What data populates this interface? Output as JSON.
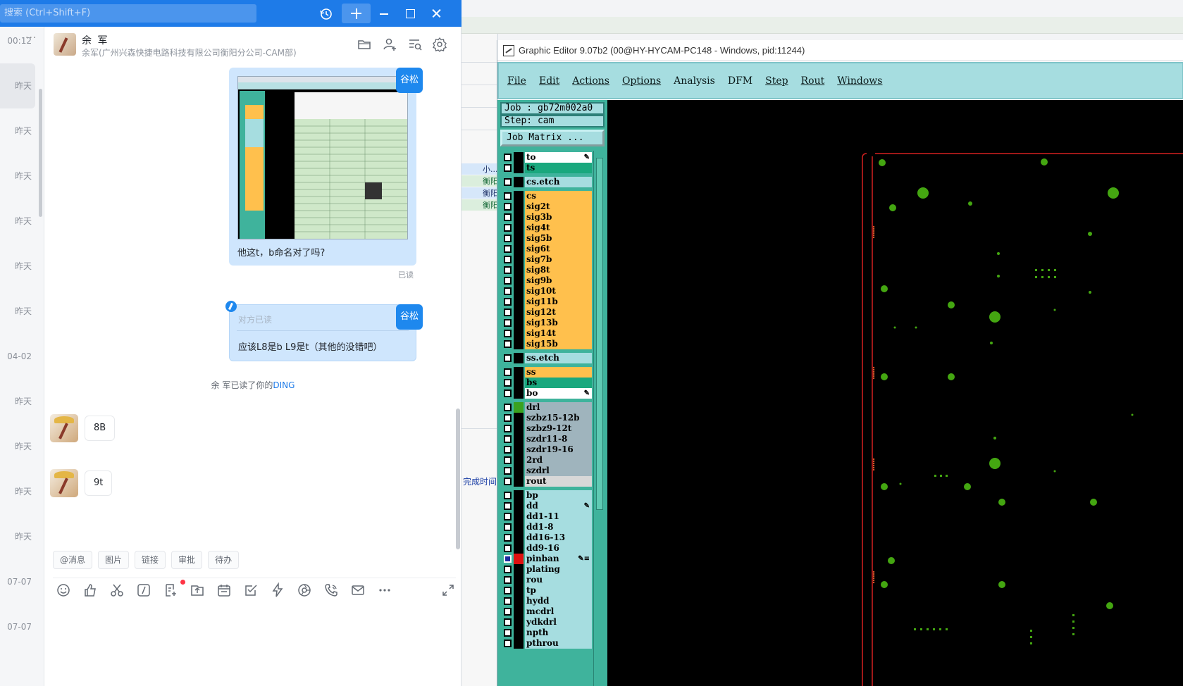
{
  "chat": {
    "search_placeholder": "搜索 (Ctrl+Shift+F)",
    "conversation_times": [
      "00:12",
      "昨天",
      "昨天",
      "昨天",
      "昨天",
      "昨天",
      "昨天",
      "04-02",
      "昨天",
      "昨天",
      "昨天",
      "昨天",
      "07-07",
      "07-07"
    ],
    "header": {
      "name": "余 军",
      "subtitle": "余军(广州兴森快捷电路科技有限公司衡阳分公司-CAM部)"
    },
    "my_name": "谷松",
    "messages": {
      "m1_text": "他这t，b命名对了吗?",
      "m1_read": "已读",
      "m2_quote": "对方已读",
      "m2_text": "应该L8是b   L9是t（其他的没错吧）",
      "ding_note_prefix": "余 军已读了你的",
      "ding_note_link": "DING",
      "reply1": "8B",
      "reply2": "9t"
    },
    "quick_tags": [
      "@消息",
      "图片",
      "链接",
      "审批",
      "待办"
    ]
  },
  "background": {
    "behind_rows": [
      "小...",
      "衡阳",
      "衡阳",
      "衡阳"
    ],
    "finish_label": "完成时间"
  },
  "graphic_editor": {
    "title": "Graphic Editor 9.07b2 (00@HY-HYCAM-PC148 - Windows, pid:11244)",
    "menus": [
      "File",
      "Edit",
      "Actions",
      "Options",
      "Analysis",
      "DFM",
      "Step",
      "Rout",
      "Windows"
    ],
    "job": "Job  : gb72m002a0",
    "step": "Step: cam",
    "job_matrix": "Job Matrix ...",
    "layers": [
      {
        "name": "to",
        "color": "#ffffff",
        "mark": "✎",
        "group": 1
      },
      {
        "name": "ts",
        "color": "#1aa87e",
        "group": 1
      },
      {
        "name": "cs.etch",
        "color": "#a6dde0",
        "group": 2
      },
      {
        "name": "cs",
        "color": "#ffc04d",
        "group": 3
      },
      {
        "name": "sig2t",
        "color": "#ffc04d",
        "group": 3
      },
      {
        "name": "sig3b",
        "color": "#ffc04d",
        "group": 3
      },
      {
        "name": "sig4t",
        "color": "#ffc04d",
        "group": 3
      },
      {
        "name": "sig5b",
        "color": "#ffc04d",
        "group": 3
      },
      {
        "name": "sig6t",
        "color": "#ffc04d",
        "group": 3
      },
      {
        "name": "sig7b",
        "color": "#ffc04d",
        "group": 3
      },
      {
        "name": "sig8t",
        "color": "#ffc04d",
        "group": 3
      },
      {
        "name": "sig9b",
        "color": "#ffc04d",
        "group": 3
      },
      {
        "name": "sig10t",
        "color": "#ffc04d",
        "group": 3
      },
      {
        "name": "sig11b",
        "color": "#ffc04d",
        "group": 3
      },
      {
        "name": "sig12t",
        "color": "#ffc04d",
        "group": 3
      },
      {
        "name": "sig13b",
        "color": "#ffc04d",
        "group": 3
      },
      {
        "name": "sig14t",
        "color": "#ffc04d",
        "group": 3
      },
      {
        "name": "sig15b",
        "color": "#ffc04d",
        "group": 3
      },
      {
        "name": "ss.etch",
        "color": "#a6dde0",
        "group": 4
      },
      {
        "name": "ss",
        "color": "#ffc04d",
        "group": 5
      },
      {
        "name": "bs",
        "color": "#1aa87e",
        "group": 5
      },
      {
        "name": "bo",
        "color": "#ffffff",
        "mark": "✎",
        "group": 5
      },
      {
        "name": "drl",
        "color": "#9fb4bd",
        "swatch": "#3aa21f",
        "group": 6
      },
      {
        "name": "szbz15-12b",
        "color": "#9fb4bd",
        "group": 6
      },
      {
        "name": "szbz9-12t",
        "color": "#9fb4bd",
        "group": 6
      },
      {
        "name": "szdr11-8",
        "color": "#9fb4bd",
        "group": 6
      },
      {
        "name": "szdr19-16",
        "color": "#9fb4bd",
        "group": 6
      },
      {
        "name": "2rd",
        "color": "#9fb4bd",
        "group": 6
      },
      {
        "name": "szdrl",
        "color": "#9fb4bd",
        "group": 6
      },
      {
        "name": "rout",
        "color": "#d8d8d8",
        "group": 6
      },
      {
        "name": "bp",
        "color": "#a6dde0",
        "group": 7
      },
      {
        "name": "dd",
        "color": "#a6dde0",
        "mark": "✎",
        "group": 7
      },
      {
        "name": "dd1-11",
        "color": "#a6dde0",
        "group": 7
      },
      {
        "name": "dd1-8",
        "color": "#a6dde0",
        "group": 7
      },
      {
        "name": "dd16-13",
        "color": "#a6dde0",
        "group": 7
      },
      {
        "name": "dd9-16",
        "color": "#a6dde0",
        "group": 7
      },
      {
        "name": "pinban",
        "color": "#a6dde0",
        "mark": "✎≡",
        "selected": true,
        "swatch": "#e01010",
        "group": 7
      },
      {
        "name": "plating",
        "color": "#a6dde0",
        "group": 7
      },
      {
        "name": "rou",
        "color": "#a6dde0",
        "group": 7
      },
      {
        "name": "tp",
        "color": "#a6dde0",
        "group": 7
      },
      {
        "name": "hydd",
        "color": "#a6dde0",
        "group": 7
      },
      {
        "name": "mcdrl",
        "color": "#a6dde0",
        "group": 7
      },
      {
        "name": "ydkdrl",
        "color": "#a6dde0",
        "group": 7
      },
      {
        "name": "npth",
        "color": "#a6dde0",
        "group": 7
      },
      {
        "name": "pthrou",
        "color": "#a6dde0",
        "group": 7
      }
    ],
    "canvas": {
      "background": "#000000",
      "outline_color": "#d42020",
      "pad_color": "#44a611"
    }
  }
}
